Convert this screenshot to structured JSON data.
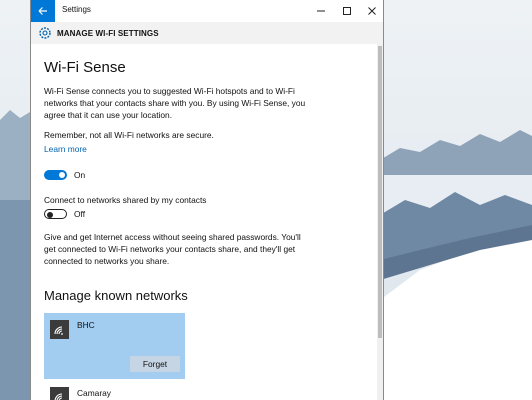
{
  "window": {
    "title": "Settings"
  },
  "header": {
    "title": "MANAGE WI-FI SETTINGS"
  },
  "content": {
    "heading": "Wi-Fi Sense",
    "description": "Wi-Fi Sense connects you to suggested Wi-Fi hotspots and to Wi-Fi networks that your contacts share with you. By using Wi-Fi Sense, you agree that it can use your location.",
    "remember": "Remember, not all Wi-Fi networks are secure.",
    "learn_more": "Learn more",
    "wifi_sense_toggle": {
      "state": "On"
    },
    "connect_contacts_label": "Connect to networks shared by my contacts",
    "contacts_toggle": {
      "state": "Off"
    },
    "share_description": "Give and get Internet access without seeing shared passwords. You'll get connected to Wi-Fi networks your contacts share, and they'll get connected to networks you share.",
    "known_networks_heading": "Manage known networks",
    "networks": [
      {
        "name": "BHC",
        "action": "Forget",
        "selected": true
      },
      {
        "name": "Camaray"
      }
    ]
  },
  "colors": {
    "accent": "#0078d7",
    "selected_card": "#a3cdf0",
    "link": "#0063b1"
  },
  "icons": {
    "back": "back-arrow-icon",
    "settings": "gear-icon",
    "network": "wifi-icon"
  }
}
